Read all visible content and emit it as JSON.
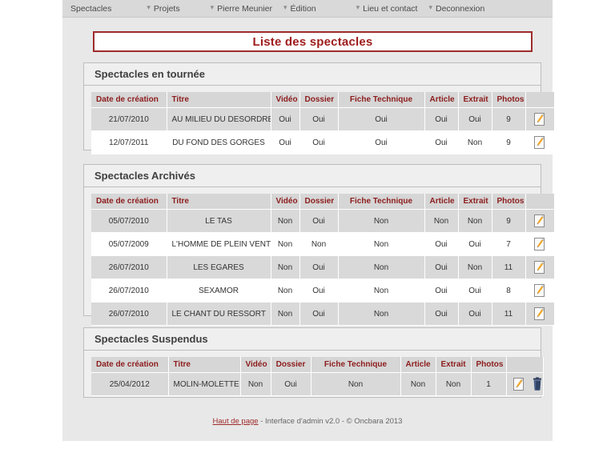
{
  "nav": {
    "items": [
      {
        "label": "Spectacles",
        "icon": "chevron-down-icon"
      },
      {
        "label": "Projets",
        "icon": "chevron-down-icon"
      },
      {
        "label": "Pierre Meunier",
        "icon": "chevron-down-icon"
      },
      {
        "label": "Édition",
        "icon": "chevron-down-icon"
      },
      {
        "label": "Lieu et contact",
        "icon": "chevron-down-icon"
      },
      {
        "label": "Deconnexion",
        "icon": ""
      }
    ],
    "separator": "▾"
  },
  "page": {
    "title": "Liste des spectacles",
    "title_color": "#9e1b1b",
    "border_color": "#9e2b2b"
  },
  "columns": {
    "date": "Date de création",
    "titre": "Titre",
    "video": "Vidéo",
    "dossier": "Dossier",
    "fiche": "Fiche Technique",
    "article": "Article",
    "extrait": "Extrait",
    "photos": "Photos",
    "actions": ""
  },
  "sections": [
    {
      "id": "tournee",
      "heading": "Spectacles en tournée",
      "rows": [
        {
          "date": "21/07/2010",
          "titre": "AU MILIEU DU DESORDRE",
          "video": "Oui",
          "dossier": "Oui",
          "fiche": "Oui",
          "article": "Oui",
          "extrait": "Oui",
          "photos": "9",
          "edit_icon": "edit-pencil-icon",
          "delete_icon": ""
        },
        {
          "date": "12/07/2011",
          "titre": "DU FOND DES GORGES",
          "video": "Oui",
          "dossier": "Oui",
          "fiche": "Oui",
          "article": "Oui",
          "extrait": "Non",
          "photos": "9",
          "edit_icon": "edit-pencil-icon",
          "delete_icon": ""
        }
      ]
    },
    {
      "id": "archives",
      "heading": "Spectacles Archivés",
      "rows": [
        {
          "date": "05/07/2010",
          "titre": "LE TAS",
          "video": "Non",
          "dossier": "Oui",
          "fiche": "Non",
          "article": "Non",
          "extrait": "Non",
          "photos": "9",
          "edit_icon": "edit-pencil-icon",
          "delete_icon": ""
        },
        {
          "date": "05/07/2009",
          "titre": "L'HOMME DE PLEIN VENT",
          "video": "Non",
          "dossier": "Non",
          "fiche": "Non",
          "article": "Oui",
          "extrait": "Oui",
          "photos": "7",
          "edit_icon": "edit-pencil-icon",
          "delete_icon": ""
        },
        {
          "date": "26/07/2010",
          "titre": "LES EGARES",
          "video": "Non",
          "dossier": "Oui",
          "fiche": "Non",
          "article": "Oui",
          "extrait": "Non",
          "photos": "11",
          "edit_icon": "edit-pencil-icon",
          "delete_icon": ""
        },
        {
          "date": "26/07/2010",
          "titre": "SEXAMOR",
          "video": "Non",
          "dossier": "Oui",
          "fiche": "Non",
          "article": "Oui",
          "extrait": "Oui",
          "photos": "8",
          "edit_icon": "edit-pencil-icon",
          "delete_icon": ""
        },
        {
          "date": "26/07/2010",
          "titre": "LE CHANT DU RESSORT",
          "video": "Non",
          "dossier": "Oui",
          "fiche": "Non",
          "article": "Oui",
          "extrait": "Oui",
          "photos": "11",
          "edit_icon": "edit-pencil-icon",
          "delete_icon": ""
        }
      ]
    },
    {
      "id": "suspendus",
      "heading": "Spectacles Suspendus",
      "rows": [
        {
          "date": "25/04/2012",
          "titre": "MOLIN-MOLETTE",
          "video": "Non",
          "dossier": "Oui",
          "fiche": "Non",
          "article": "Non",
          "extrait": "Non",
          "photos": "1",
          "edit_icon": "edit-pencil-icon",
          "delete_icon": "trash-icon"
        }
      ]
    }
  ],
  "footer": {
    "link": "Haut de page",
    "text": " - Interface d'admin v2.0 - © Oncbara 2013"
  }
}
